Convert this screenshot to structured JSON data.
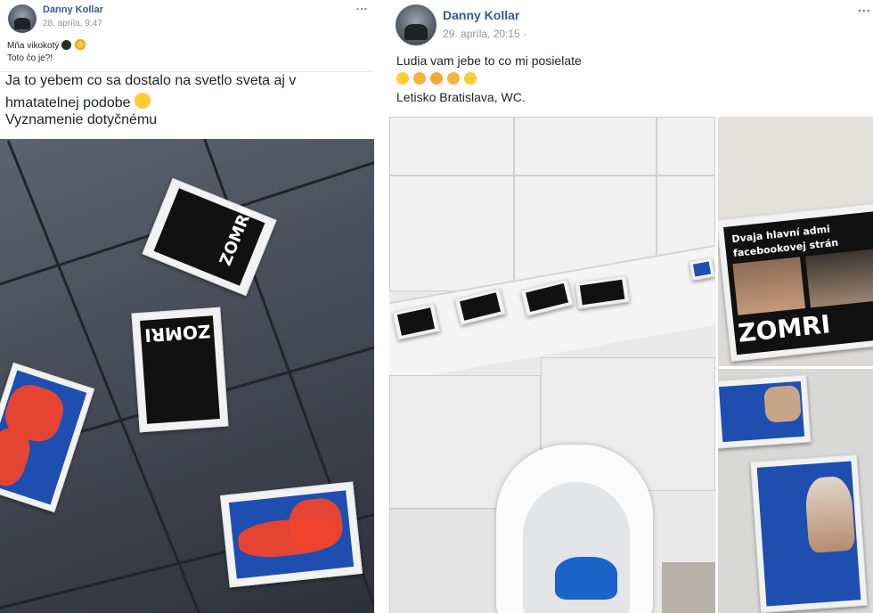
{
  "left_post": {
    "author": "Danny Kollar",
    "timestamp": "28. apríla, 9:47",
    "more_label": "...",
    "caption_line1": "Mňa vikokotý",
    "caption_line2": "Toto čo je?!",
    "body_line1": "Ja to yebem co sa dostalo na svetlo sveta aj v",
    "body_line2": "hmatatelnej podobe",
    "body_line3": "Vyznamenie dotyčnému",
    "flyer_word": "ZOMRI"
  },
  "right_post": {
    "author": "Danny Kollar",
    "timestamp": "29. apríla, 20:15 ·",
    "more_label": "...",
    "text_line1": "Ludia vam jebe to co mi posielate",
    "text_line3": "Letisko Bratislava, WC.",
    "poster_line1": "Dvaja hlavní admi",
    "poster_line2": "facebookovej strán",
    "flyer_word": "ZOMRI"
  },
  "icons": [
    "bomb-emoji",
    "explosion-emoji",
    "grinning-emoji",
    "rock-hand-emoji",
    "muscle-emoji",
    "ok-hand-emoji",
    "tongue-emoji"
  ],
  "colors": {
    "link": "#385898",
    "meta": "#90949c",
    "text": "#1d2129",
    "flyer_blue": "#1e4fb0",
    "scribble_red": "#f0432c"
  }
}
